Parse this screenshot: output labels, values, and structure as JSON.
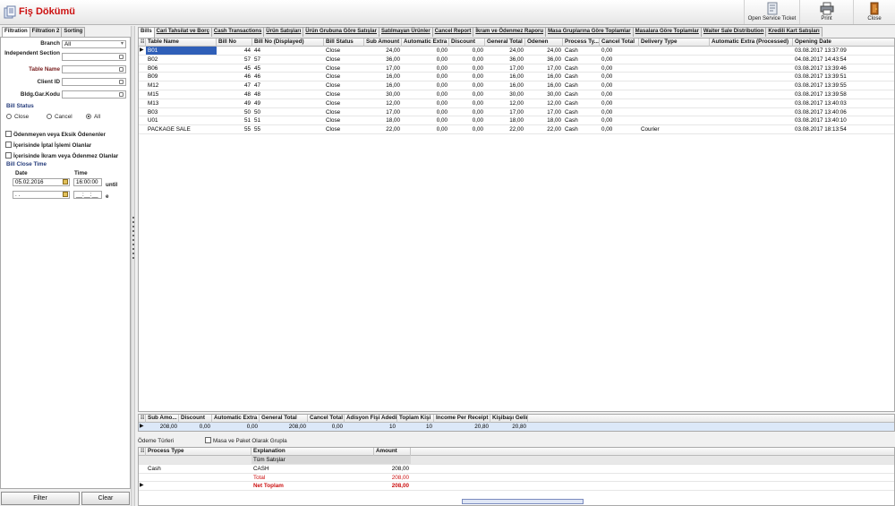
{
  "app": {
    "title": "Fiş Dökümü"
  },
  "toolbar": {
    "open_service_ticket": "Open Service Ticket",
    "print": "Print",
    "close": "Close"
  },
  "left_tabs": [
    "Filtration",
    "Filtration 2",
    "Sorting"
  ],
  "filters": {
    "branch_label": "Branch",
    "branch_value": "All",
    "independent_section_label": "Independent Section",
    "table_name_label": "Table Name",
    "client_id_label": "Client ID",
    "bldg_gar_kodu_label": "Bldg.Gar.Kodu"
  },
  "bill_status": {
    "title": "Bill Status",
    "close": "Close",
    "cancel": "Cancel",
    "all": "All",
    "selected": "All"
  },
  "checkboxes": [
    "Ödenmeyen veya Eksik Ödenenler",
    "İçerisinde İptal İşlemi Olanlar",
    "İçerisinde İkram veya Ödenmez Olanlar"
  ],
  "bill_close_time": {
    "title": "Bill Close Time",
    "date_label": "Date",
    "time_label": "Time",
    "from_date": "05.02.2016",
    "from_time": "16:00:00",
    "until": "until",
    "to_date": ". .",
    "to_time": "__:__:__",
    "to_suffix": "e"
  },
  "buttons": {
    "filter": "Filter",
    "clear": "Clear"
  },
  "main_tabs": [
    "Bills",
    "Cari Tahsilat ve Borç",
    "Cash Transactions",
    "Ürün Satışları",
    "Ürün Grubuna Göre Satışlar",
    "Satılmayan Ürünler",
    "Cancel Report",
    "İkram ve Ödenmez Raporu",
    "Masa Gruplarına Göre Toplamlar",
    "Masalara Göre Toplamlar",
    "Waiter Sale Distribution",
    "Kredili Kart Satışları"
  ],
  "bills_table": {
    "columns": [
      "Table Name",
      "Bill No",
      "Bill No (Displayed)",
      "Bill Status",
      "Sub Amount",
      "Automatic Extra",
      "Discount",
      "General Total",
      "Ödenen",
      "Process Ty...",
      "Cancel Total",
      "Delivery Type",
      "Automatic Extra (Processed)",
      "Opening Date"
    ],
    "rows": [
      [
        "B01",
        "44",
        "44",
        "Close",
        "24,00",
        "0,00",
        "0,00",
        "24,00",
        "24,00",
        "Cash",
        "0,00",
        "",
        "",
        "03.08.2017 13:37:09"
      ],
      [
        "B02",
        "57",
        "57",
        "Close",
        "36,00",
        "0,00",
        "0,00",
        "36,00",
        "36,00",
        "Cash",
        "0,00",
        "",
        "",
        "04.08.2017 14:43:54"
      ],
      [
        "B06",
        "45",
        "45",
        "Close",
        "17,00",
        "0,00",
        "0,00",
        "17,00",
        "17,00",
        "Cash",
        "0,00",
        "",
        "",
        "03.08.2017 13:39:46"
      ],
      [
        "B09",
        "46",
        "46",
        "Close",
        "16,00",
        "0,00",
        "0,00",
        "16,00",
        "16,00",
        "Cash",
        "0,00",
        "",
        "",
        "03.08.2017 13:39:51"
      ],
      [
        "M12",
        "47",
        "47",
        "Close",
        "16,00",
        "0,00",
        "0,00",
        "16,00",
        "16,00",
        "Cash",
        "0,00",
        "",
        "",
        "03.08.2017 13:39:55"
      ],
      [
        "M15",
        "48",
        "48",
        "Close",
        "30,00",
        "0,00",
        "0,00",
        "30,00",
        "30,00",
        "Cash",
        "0,00",
        "",
        "",
        "03.08.2017 13:39:58"
      ],
      [
        "M13",
        "49",
        "49",
        "Close",
        "12,00",
        "0,00",
        "0,00",
        "12,00",
        "12,00",
        "Cash",
        "0,00",
        "",
        "",
        "03.08.2017 13:40:03"
      ],
      [
        "B03",
        "50",
        "50",
        "Close",
        "17,00",
        "0,00",
        "0,00",
        "17,00",
        "17,00",
        "Cash",
        "0,00",
        "",
        "",
        "03.08.2017 13:40:06"
      ],
      [
        "U01",
        "51",
        "51",
        "Close",
        "18,00",
        "0,00",
        "0,00",
        "18,00",
        "18,00",
        "Cash",
        "0,00",
        "",
        "",
        "03.08.2017 13:40:10"
      ],
      [
        "PACKAGE SALE",
        "55",
        "55",
        "Close",
        "22,00",
        "0,00",
        "0,00",
        "22,00",
        "22,00",
        "Cash",
        "0,00",
        "Courier",
        "",
        "03.08.2017 18:13:54"
      ]
    ]
  },
  "summary_table": {
    "columns": [
      "Sub Amo...",
      "Discount",
      "Automatic Extra",
      "General Total",
      "Cancel Total",
      "Adisyon Fişi Adedi",
      "Toplam Kişi",
      "Income Per Receipt",
      "Kişibaşı Gelir"
    ],
    "row": [
      "208,00",
      "0,00",
      "0,00",
      "208,00",
      "0,00",
      "10",
      "10",
      "20,80",
      "20,80"
    ]
  },
  "payment": {
    "label": "Ödeme Türleri",
    "group_checkbox": "Masa ve Paket Olarak Grupla",
    "columns": [
      "Process Type",
      "Explanation",
      "Amount"
    ],
    "group_header": "Tüm Satışlar",
    "rows": [
      [
        "Cash",
        "CASH",
        "208,00"
      ],
      [
        "",
        "Total",
        "208,00"
      ],
      [
        "",
        "Net Toplam",
        "208,00"
      ]
    ]
  },
  "colors": {
    "title_red": "#cc1010",
    "total_red": "#cc1010",
    "selection": "#2f5fb8",
    "section_blue": "#233a7a"
  }
}
